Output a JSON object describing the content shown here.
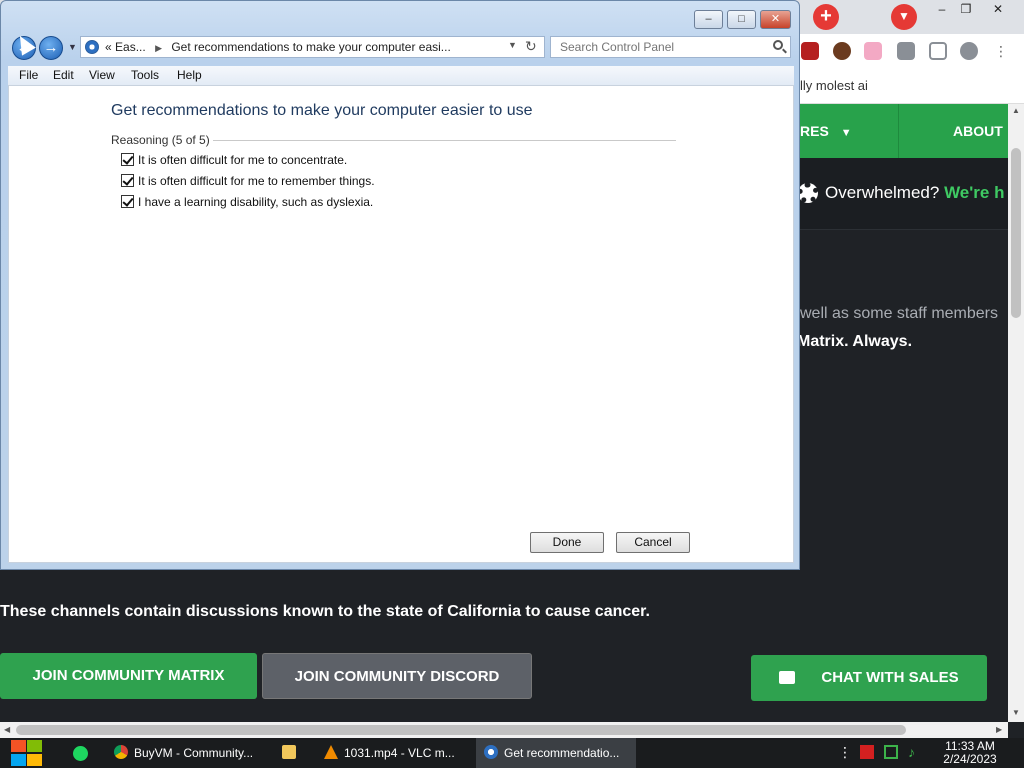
{
  "browser": {
    "bookmark_text": "lly molest ai",
    "nav_items": [
      "RES",
      "ABOUT U"
    ],
    "help_prefix": "Overwhelmed?",
    "help_accent": "We're h",
    "staff_text": "well as some staff members",
    "matrix_text": "Matrix. Always.",
    "cancer_text": "These channels contain discussions known to the state of California to cause cancer.",
    "buttons": {
      "join_matrix": "JOIN COMMUNITY MATRIX",
      "join_discord": "JOIN COMMUNITY DISCORD",
      "chat_sales": "CHAT WITH SALES"
    },
    "window_controls": [
      "–",
      "❐",
      "✕"
    ]
  },
  "control_panel": {
    "window_controls": [
      "–",
      "□",
      "✕"
    ],
    "address": {
      "prefix": "«",
      "crumb_1": "Eas...",
      "separator": "▶",
      "crumb_2": "Get recommendations to make your computer easi..."
    },
    "search_placeholder": "Search Control Panel",
    "menu": [
      "File",
      "Edit",
      "View",
      "Tools",
      "Help"
    ],
    "heading": "Get recommendations to make your computer easier to use",
    "group_label": "Reasoning (5 of 5)",
    "checkboxes": [
      {
        "label": "It is often difficult for me to concentrate.",
        "checked": true
      },
      {
        "label": "It is often difficult for me to remember things.",
        "checked": true
      },
      {
        "label": "I have a learning disability, such as dyslexia.",
        "checked": true
      }
    ],
    "done_label": "Done",
    "cancel_label": "Cancel"
  },
  "taskbar": {
    "tasks": [
      {
        "label": "BuyVM - Community...",
        "icon": "chrome-icon"
      },
      {
        "label": "",
        "icon": "folder-icon"
      },
      {
        "label": "1031.mp4 - VLC m...",
        "icon": "vlc-icon"
      },
      {
        "label": "Get recommendatio...",
        "icon": "control-panel-icon"
      }
    ],
    "time": "11:33 AM",
    "date": "2/24/2023"
  },
  "colors": {
    "site_green": "#28a24b",
    "accent_green": "#3fca63",
    "site_dark": "#1b1e22"
  }
}
